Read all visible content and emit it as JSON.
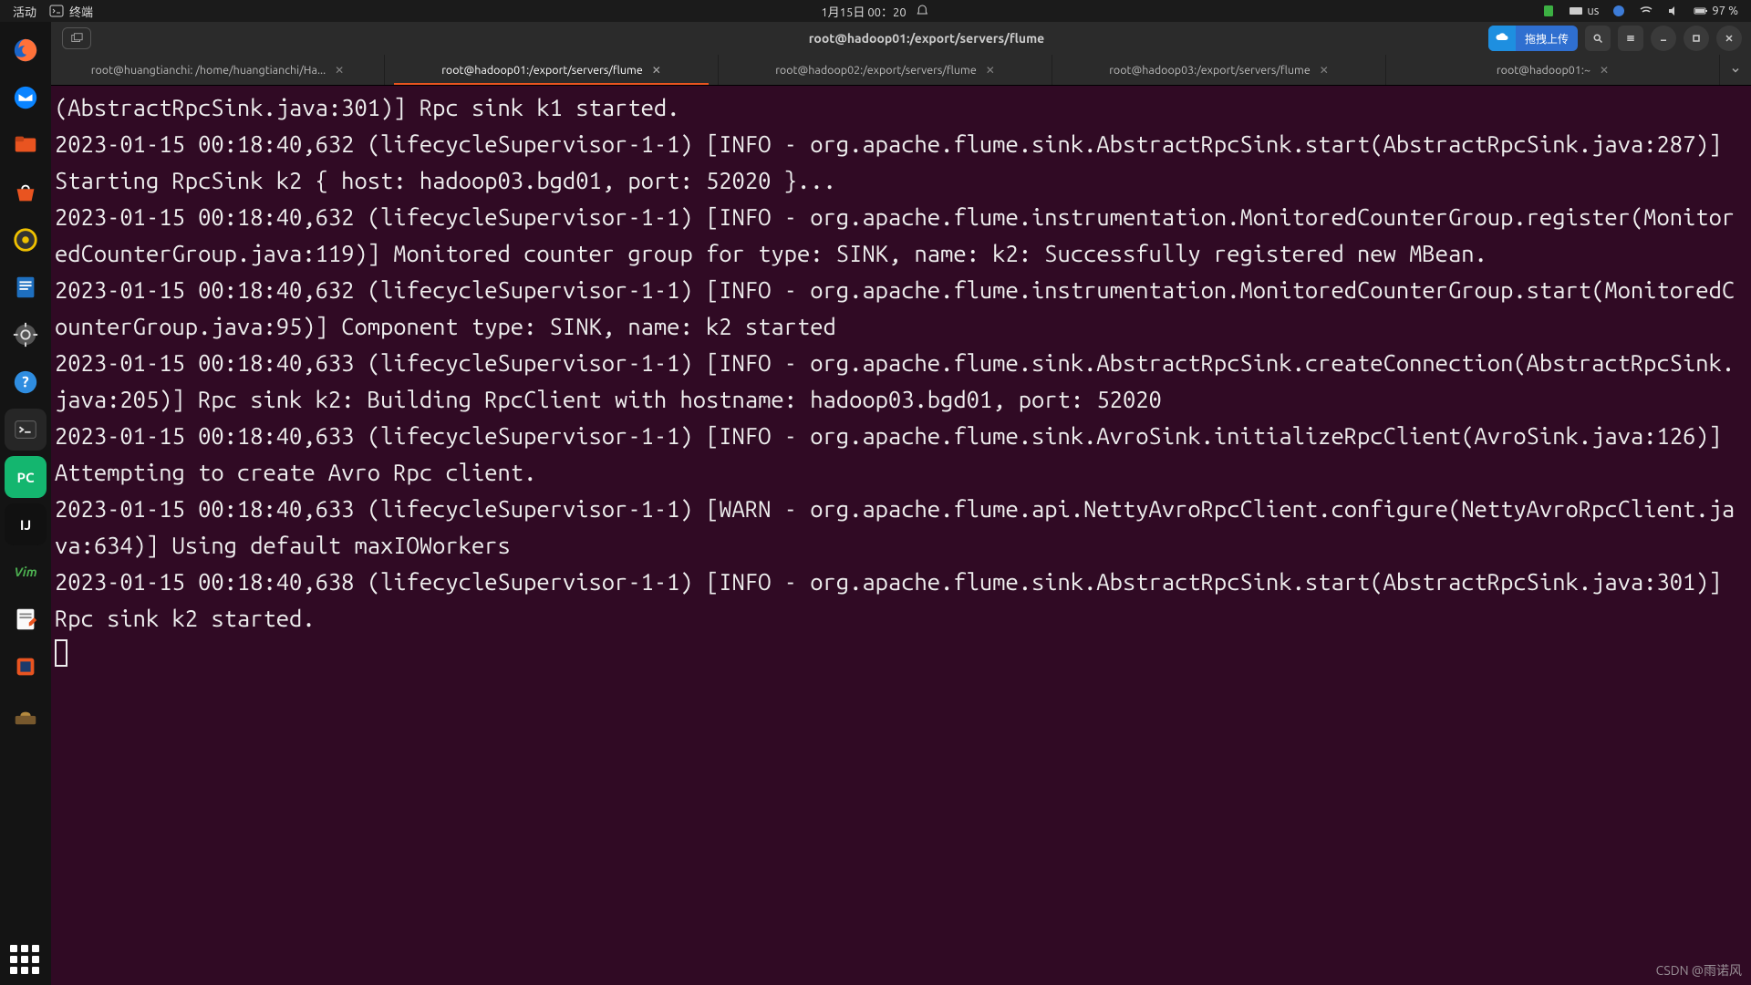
{
  "topbar": {
    "activities": "活动",
    "app_label": "终端",
    "clock": "1月15日 00：20",
    "input_method": "us",
    "battery": "97 %"
  },
  "dock": {
    "items": [
      {
        "name": "firefox"
      },
      {
        "name": "thunderbird"
      },
      {
        "name": "files"
      },
      {
        "name": "software"
      },
      {
        "name": "rhythmbox"
      },
      {
        "name": "libreoffice-writer"
      },
      {
        "name": "settings"
      },
      {
        "name": "help"
      },
      {
        "name": "terminal"
      },
      {
        "name": "pycharm",
        "label": "PC"
      },
      {
        "name": "intellij",
        "label": "IJ"
      },
      {
        "name": "vim",
        "label": "Vim"
      },
      {
        "name": "gedit"
      },
      {
        "name": "virtualbox"
      },
      {
        "name": "screenshot"
      }
    ]
  },
  "window": {
    "title": "root@hadoop01:/export/servers/flume",
    "upload_label": "拖拽上传"
  },
  "tabs": [
    {
      "label": "root@huangtianchi: /home/huangtianchi/Ha...",
      "active": false,
      "closable": true
    },
    {
      "label": "root@hadoop01:/export/servers/flume",
      "active": true,
      "closable": true
    },
    {
      "label": "root@hadoop02:/export/servers/flume",
      "active": false,
      "closable": true
    },
    {
      "label": "root@hadoop03:/export/servers/flume",
      "active": false,
      "closable": true
    },
    {
      "label": "root@hadoop01:~",
      "active": false,
      "closable": true
    }
  ],
  "terminal": {
    "text": "(AbstractRpcSink.java:301)] Rpc sink k1 started.\n2023-01-15 00:18:40,632 (lifecycleSupervisor-1-1) [INFO - org.apache.flume.sink.AbstractRpcSink.start(AbstractRpcSink.java:287)] Starting RpcSink k2 { host: hadoop03.bgd01, port: 52020 }...\n2023-01-15 00:18:40,632 (lifecycleSupervisor-1-1) [INFO - org.apache.flume.instrumentation.MonitoredCounterGroup.register(MonitoredCounterGroup.java:119)] Monitored counter group for type: SINK, name: k2: Successfully registered new MBean.\n2023-01-15 00:18:40,632 (lifecycleSupervisor-1-1) [INFO - org.apache.flume.instrumentation.MonitoredCounterGroup.start(MonitoredCounterGroup.java:95)] Component type: SINK, name: k2 started\n2023-01-15 00:18:40,633 (lifecycleSupervisor-1-1) [INFO - org.apache.flume.sink.AbstractRpcSink.createConnection(AbstractRpcSink.java:205)] Rpc sink k2: Building RpcClient with hostname: hadoop03.bgd01, port: 52020\n2023-01-15 00:18:40,633 (lifecycleSupervisor-1-1) [INFO - org.apache.flume.sink.AvroSink.initializeRpcClient(AvroSink.java:126)] Attempting to create Avro Rpc client.\n2023-01-15 00:18:40,633 (lifecycleSupervisor-1-1) [WARN - org.apache.flume.api.NettyAvroRpcClient.configure(NettyAvroRpcClient.java:634)] Using default maxIOWorkers\n2023-01-15 00:18:40,638 (lifecycleSupervisor-1-1) [INFO - org.apache.flume.sink.AbstractRpcSink.start(AbstractRpcSink.java:301)] Rpc sink k2 started."
  },
  "watermark": "CSDN @雨诺风"
}
